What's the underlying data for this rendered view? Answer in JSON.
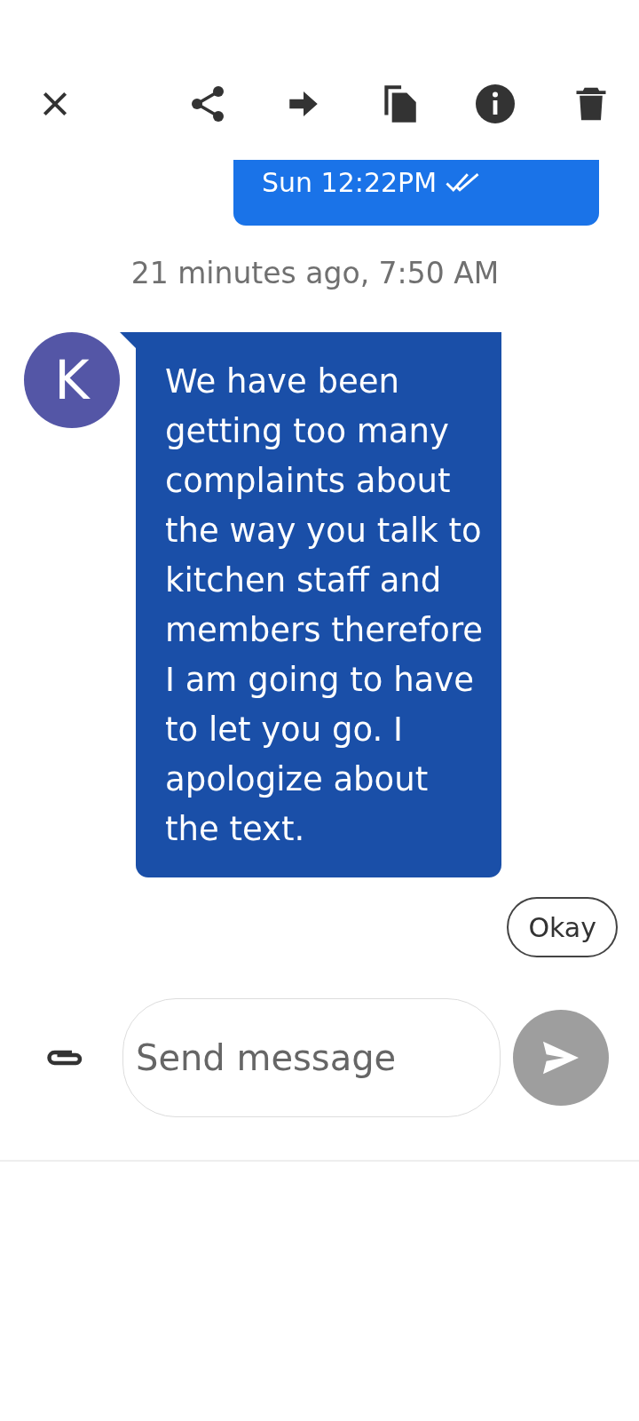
{
  "messages": [
    {
      "kind": "sent",
      "time": "Sun 12:22PM",
      "read": true
    },
    {
      "kind": "timestamp",
      "text": "21 minutes ago, 7:50 AM"
    },
    {
      "kind": "received",
      "avatar": "K",
      "text": "We have been getting too many complaints about the way you talk to kitchen staff and members therefore I am going to have to let you go. I apologize about the text."
    }
  ],
  "suggestions": [
    {
      "label": "Okay"
    }
  ],
  "composer": {
    "placeholder": "Send message",
    "send_enabled": false
  }
}
